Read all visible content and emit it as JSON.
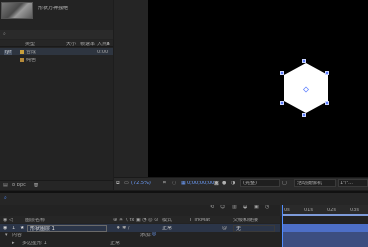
{
  "project": {
    "comp_thumb_title": "形状万神独绝",
    "columns": {
      "name": "类型",
      "size": "大小",
      "fps": "帧速率",
      "in_point": "入点"
    },
    "rows": [
      {
        "tag": "lyr",
        "name": "",
        "type": "合成",
        "size": "",
        "fps": "",
        "in_point": "0:00",
        "color": "#c8a03c"
      },
      {
        "tag": "",
        "name": "",
        "type": "纯色",
        "size": "",
        "fps": "",
        "in_point": "",
        "color": "#b58a3a"
      }
    ],
    "bpc": "8 bpc"
  },
  "viewer": {
    "zoom": "(72.5%)",
    "timecode": "0;00;00;00",
    "resolution": "(完整)",
    "camera": "活动摄像机",
    "views": "1个..."
  },
  "timeline": {
    "columns": {
      "source_name": "图层名称",
      "mode": "模式",
      "trkmat": "T TrkMat",
      "parent": "父级和链接"
    },
    "layer": {
      "index": "1",
      "star": "★",
      "name": "形状图层 1",
      "mode": "正常",
      "parent": "无"
    },
    "content_label": "内容",
    "add_label": "添加:",
    "shape_label": "多边星形 1",
    "shape_mode": "正常",
    "ruler": [
      "0s",
      "01s",
      "02s",
      "03s"
    ],
    "playhead_fraction": 0.0
  },
  "colors": {
    "accent": "#4f8dff",
    "layer_bar": "#4d6fc7"
  }
}
